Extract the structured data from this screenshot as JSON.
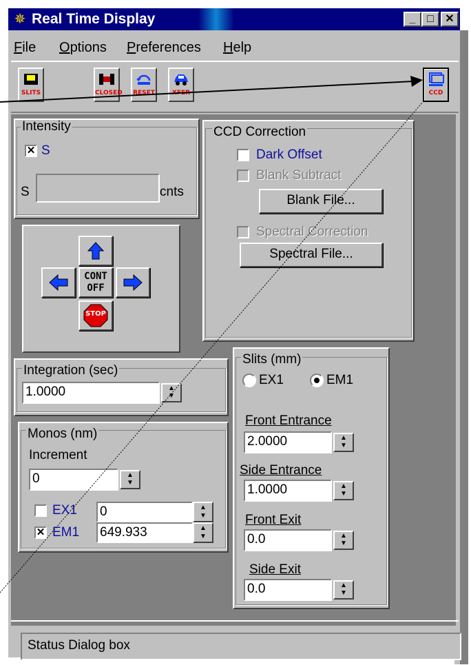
{
  "window": {
    "title": "Real Time Display",
    "minimize": "_",
    "maximize": "□",
    "close": "✕"
  },
  "menu": [
    {
      "label": "File",
      "ul": "F",
      "rest": "ile"
    },
    {
      "label": "Options",
      "ul": "O",
      "rest": "ptions"
    },
    {
      "label": "Preferences",
      "ul": "P",
      "rest": "references"
    },
    {
      "label": "Help",
      "ul": "H",
      "rest": "elp"
    }
  ],
  "toolbar": {
    "slits": "SLITS",
    "closed": "CLOSED",
    "reset": "RESET",
    "xfer": "XFER",
    "ccd": "CCD"
  },
  "intensity": {
    "title": "Intensity",
    "checkbox_label": "S",
    "checked": true,
    "field_label": "S",
    "value": "",
    "unit": "cnts"
  },
  "ccd_correction": {
    "title": "CCD Correction",
    "dark_offset": "Dark Offset",
    "blank_subtract": "Blank Subtract",
    "blank_file": "Blank File...",
    "spectral_correction": "Spectral Correction",
    "spectral_file": "Spectral File..."
  },
  "motion": {
    "cont_line1": "CONT",
    "cont_line2": "OFF",
    "stop": "STOP"
  },
  "integration": {
    "title": "Integration (sec)",
    "value": "1.0000"
  },
  "monos": {
    "title": "Monos (nm)",
    "increment_label": "Increment",
    "increment_value": "0",
    "ex1_label": "EX1",
    "ex1_value": "0",
    "ex1_checked": false,
    "em1_label": "EM1",
    "em1_value": "649.933",
    "em1_checked": true
  },
  "slits": {
    "title": "Slits (mm)",
    "ex1": "EX1",
    "em1": "EM1",
    "selected": "EM1",
    "front_entrance_label": "Front Entrance",
    "front_entrance": "2.0000",
    "side_entrance_label": "Side Entrance",
    "side_entrance": "1.0000",
    "front_exit_label": "Front Exit",
    "front_exit": "0.0",
    "side_exit_label": "Side Exit",
    "side_exit": "0.0"
  },
  "status": {
    "text": "Status Dialog box"
  },
  "colors": {
    "title_bar": "#000080",
    "face": "#c0c0c0",
    "shadow": "#808080",
    "label_blue": "#1010a0",
    "icon_red": "#e00000",
    "arrow_blue": "#1040ff"
  }
}
